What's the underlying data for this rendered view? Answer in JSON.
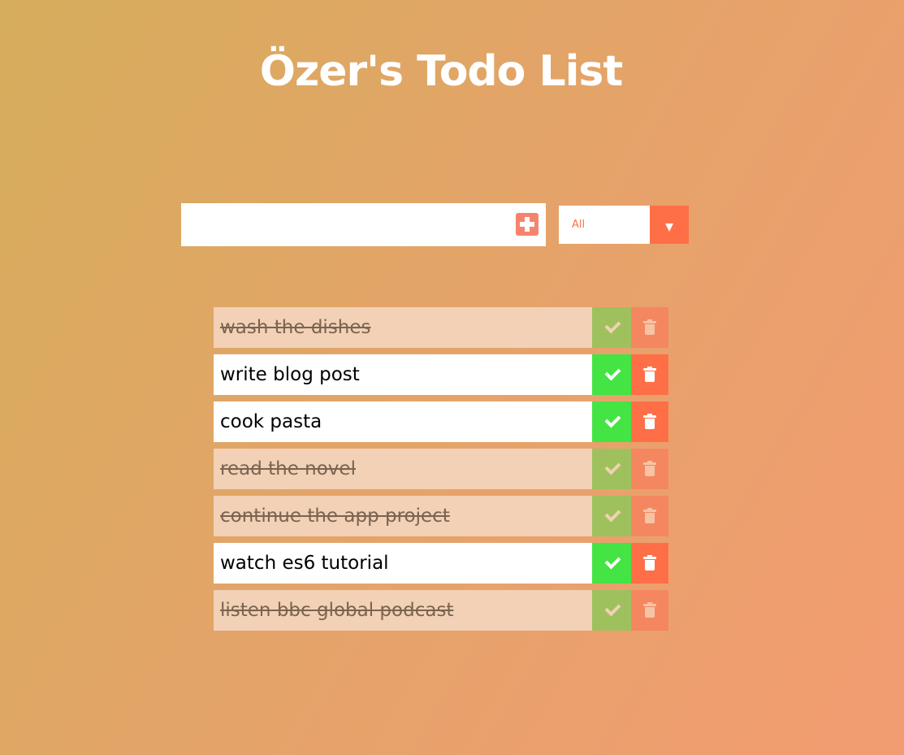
{
  "header": {
    "title": "Özer's Todo List"
  },
  "form": {
    "input_value": "",
    "add_icon": "plus-square-icon"
  },
  "filter": {
    "selected": "All",
    "arrow_icon": "caret-down-icon"
  },
  "todos": [
    {
      "text": "wash the dishes",
      "completed": true
    },
    {
      "text": "write blog post",
      "completed": false
    },
    {
      "text": "cook pasta",
      "completed": false
    },
    {
      "text": "read the novel",
      "completed": true
    },
    {
      "text": "continue the app project",
      "completed": true
    },
    {
      "text": "watch es6 tutorial",
      "completed": false
    },
    {
      "text": "listen bbc global podcast",
      "completed": true
    }
  ],
  "icons": {
    "complete": "check-icon",
    "delete": "trash-icon"
  },
  "colors": {
    "accent": "#ff6f47",
    "complete_button": "#44e444",
    "completed_item_bg": "#f2d1b6",
    "title": "#ffffff"
  }
}
